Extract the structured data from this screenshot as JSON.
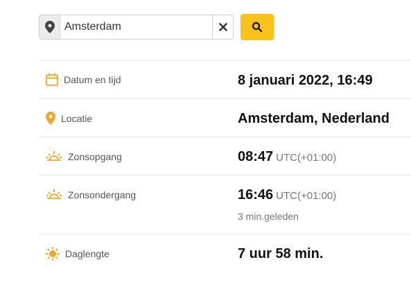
{
  "search": {
    "value": "Amsterdam",
    "location_icon": "map-marker-icon",
    "clear_icon": "close-icon",
    "submit_icon": "search-icon",
    "accent_color": "#fbc21c"
  },
  "rows": [
    {
      "label": "Datum en tijd",
      "icon": "calendar-icon",
      "value": "8 januari 2022, 16:49"
    },
    {
      "label": "Locatie",
      "icon": "map-pin-icon",
      "value": "Amsterdam, Nederland"
    },
    {
      "label": "Zonsopgang",
      "icon": "sunrise-icon",
      "value": "08:47",
      "tz": "UTC(+01:00)"
    },
    {
      "label": "Zonsondergang",
      "icon": "sunset-icon",
      "value": "16:46",
      "tz": "UTC(+01:00)",
      "sub": "3 min.geleden"
    },
    {
      "label": "Daglengte",
      "icon": "sun-icon",
      "value": "7 uur 58 min."
    }
  ]
}
